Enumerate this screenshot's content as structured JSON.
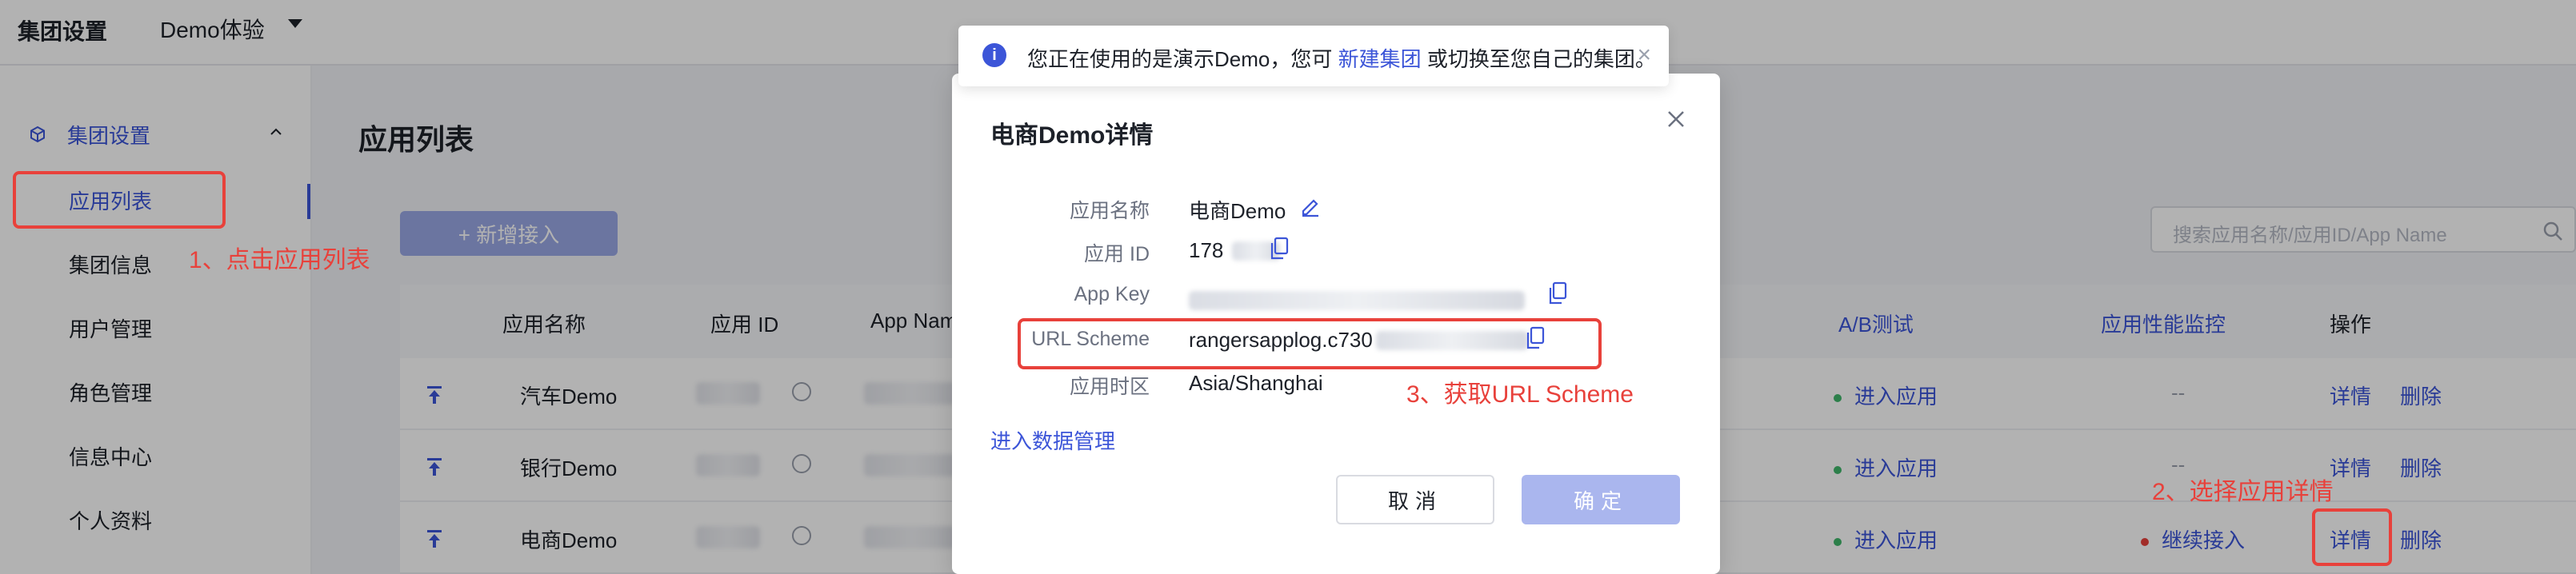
{
  "topbar": {
    "brand": "集团设置",
    "project": "Demo体验"
  },
  "sidebar": {
    "group_label": "集团设置",
    "items": [
      {
        "label": "应用列表"
      },
      {
        "label": "集团信息"
      },
      {
        "label": "用户管理"
      },
      {
        "label": "角色管理"
      },
      {
        "label": "信息中心"
      },
      {
        "label": "个人资料"
      }
    ]
  },
  "main": {
    "title": "应用列表",
    "add_button": "+ 新增接入",
    "search_placeholder": "搜索应用名称/应用ID/App Name"
  },
  "table": {
    "headers": {
      "name": "应用名称",
      "id": "应用 ID",
      "app_name": "App Name",
      "ab": "A/B测试",
      "perf": "应用性能监控",
      "ops": "操作"
    },
    "rows": [
      {
        "name": "汽车Demo",
        "ab": "进入应用",
        "perf": "--",
        "detail": "详情",
        "delete": "删除"
      },
      {
        "name": "银行Demo",
        "ab": "进入应用",
        "perf": "--",
        "detail": "详情",
        "delete": "删除"
      },
      {
        "name": "电商Demo",
        "ab": "进入应用",
        "perf": "继续接入",
        "detail": "详情",
        "delete": "删除"
      }
    ]
  },
  "notice": {
    "before": "您正在使用的是演示Demo，您可 ",
    "link": "新建集团",
    "after": " 或切换至您自己的集团。"
  },
  "modal": {
    "title": "电商Demo详情",
    "fields": {
      "app_name_label": "应用名称",
      "app_name_value": "电商Demo",
      "app_id_label": "应用 ID",
      "app_id_value": "178",
      "app_key_label": "App Key",
      "url_scheme_label": "URL Scheme",
      "url_scheme_value": "rangersapplog.c730",
      "tz_label": "应用时区",
      "tz_value": "Asia/Shanghai"
    },
    "data_link": "进入数据管理",
    "cancel": "取消",
    "ok": "确定"
  },
  "annotations": {
    "step1": "1、点击应用列表",
    "step2": "2、选择应用详情",
    "step3": "3、获取URL Scheme"
  },
  "colors": {
    "accent": "#3c55d8",
    "annotation": "#e8413b"
  }
}
